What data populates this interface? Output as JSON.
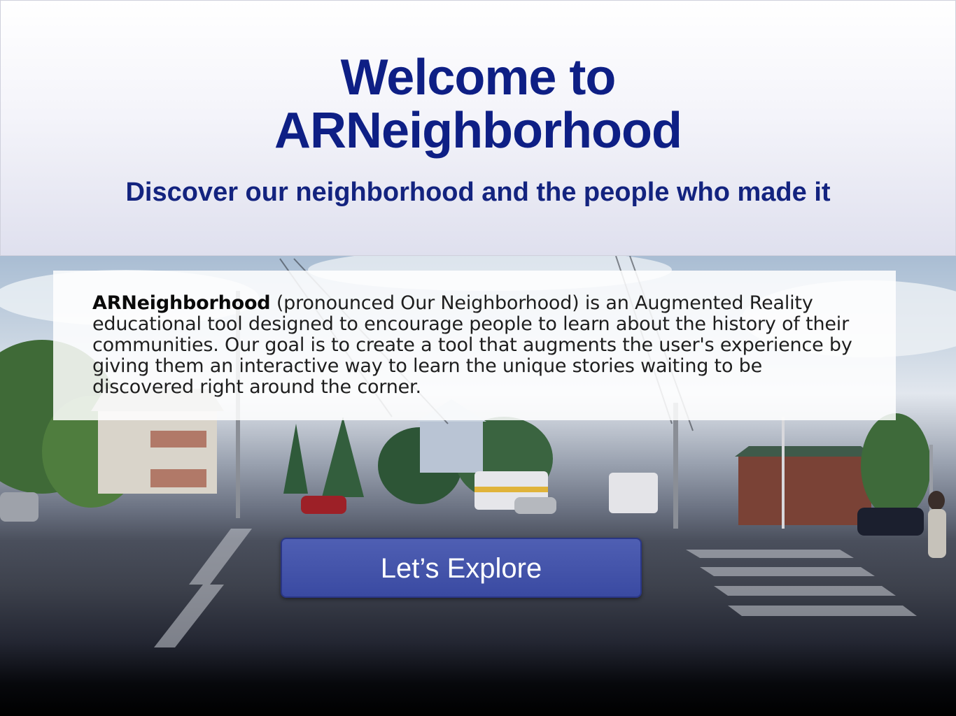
{
  "hero": {
    "title_line1": "Welcome to",
    "title_line2": "ARNeighborhood",
    "subtitle": "Discover our neighborhood and the people who made it"
  },
  "about": {
    "name": "ARNeighborhood",
    "text": " (pronounced Our Neighborhood) is an Augmented Reality educational tool designed to encourage people to learn about the history of their communities. Our goal is to create a tool that augments the user's experience by giving them an interactive way to learn the unique stories waiting to be discovered right around the corner."
  },
  "cta": {
    "label": "Let’s Explore"
  },
  "colors": {
    "title": "#0e1f85",
    "subtitle": "#13237f",
    "button": "#3a4aa2"
  }
}
